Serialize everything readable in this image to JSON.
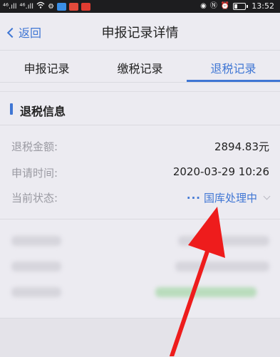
{
  "status_bar": {
    "left_indicators": [
      "⁴⁶.ıll",
      "⁴⁶.ıll",
      "wifi-icon"
    ],
    "time": "13:52"
  },
  "nav": {
    "back_label": "返回",
    "title": "申报记录详情"
  },
  "tabs": [
    {
      "label": "申报记录",
      "active": false
    },
    {
      "label": "缴税记录",
      "active": false
    },
    {
      "label": "退税记录",
      "active": true
    }
  ],
  "section": {
    "title": "退税信息"
  },
  "fields": [
    {
      "key": "退税金额:",
      "value": "2894.83元"
    },
    {
      "key": "申请时间:",
      "value": "2020-03-29 10:26"
    },
    {
      "key": "当前状态:",
      "value": "国库处理中",
      "prefix": "···"
    }
  ],
  "colors": {
    "accent": "#3f76d4",
    "background": "#ecebf1",
    "arrow": "#ee1c1c"
  }
}
